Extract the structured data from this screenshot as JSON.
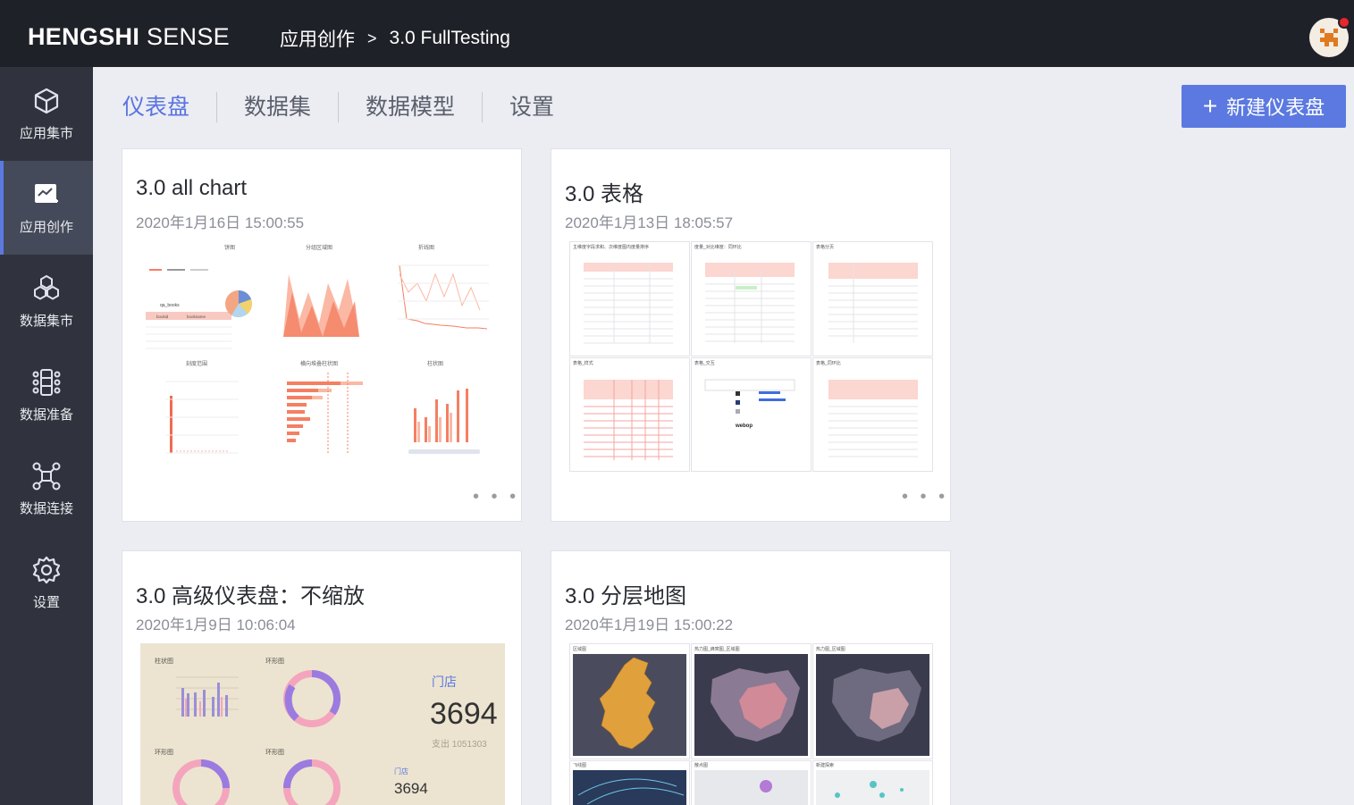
{
  "app": {
    "logo_bold": "HENGSHI",
    "logo_light": "SENSE"
  },
  "breadcrumb": {
    "section": "应用创作",
    "separator": ">",
    "app": "3.0 FullTesting"
  },
  "sidebar": {
    "items": [
      {
        "label": "应用集市",
        "icon": "cube-icon"
      },
      {
        "label": "应用创作",
        "icon": "chart-edit-icon"
      },
      {
        "label": "数据集市",
        "icon": "dataset-hub-icon"
      },
      {
        "label": "数据准备",
        "icon": "data-prep-icon"
      },
      {
        "label": "数据连接",
        "icon": "connection-icon"
      },
      {
        "label": "设置",
        "icon": "gear-icon"
      }
    ]
  },
  "tabs": [
    "仪表盘",
    "数据集",
    "数据模型",
    "设置"
  ],
  "new_button": "新建仪表盘",
  "cards": [
    {
      "title": "3.0 all chart",
      "date": "2020年1月16日 15:00:55",
      "thumb_labels": [
        "饼图",
        "分组区域图",
        "折线图",
        "刻度范围",
        "横向堆叠柱状图",
        "柱状图"
      ],
      "thumb_table": {
        "title": "qa_books",
        "headers": [
          "bookid",
          "bookname"
        ]
      }
    },
    {
      "title": "3.0 表格",
      "date": "2020年1月13日 18:05:57",
      "thumb_labels": [
        "主维度字段求和、次维度图内度量排序",
        "度量_对比维度：同环比",
        "表格分页",
        "表格_样式",
        "表格_交互",
        "表格_同环比"
      ]
    },
    {
      "title": "3.0 高级仪表盘：不缩放",
      "date": "2020年1月9日 10:06:04",
      "thumb_labels": [
        "柱状图",
        "环形图",
        "环形图",
        "环形图"
      ],
      "kpi": {
        "label": "门店",
        "value": "3694",
        "sub": "支出 1051303",
        "label2": "门店",
        "value2": "3694"
      }
    },
    {
      "title": "3.0 分层地图",
      "date": "2020年1月19日 15:00:22",
      "thumb_labels": [
        "区域图",
        "热力图_蜂窝图_区域图",
        "热力图_区域图",
        "飞线图",
        "散点图",
        "新建探索"
      ]
    }
  ],
  "more_dots": "• • •",
  "colors": {
    "topbar": "#1f2128",
    "sidebar": "#30333d",
    "accent": "#5b79e0",
    "chart_salmon": "#f47f62"
  }
}
